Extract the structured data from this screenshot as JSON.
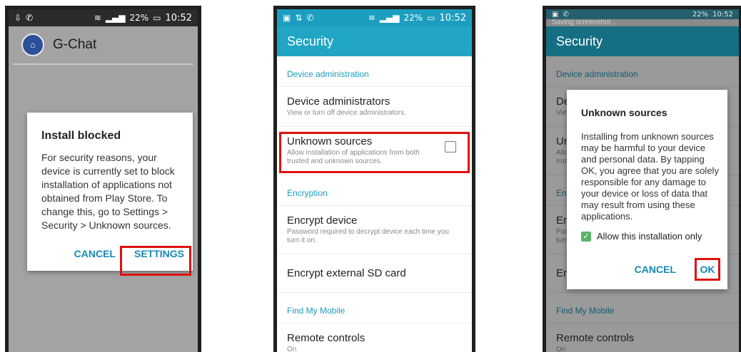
{
  "status_bar": {
    "time": "10:52",
    "battery": "22%"
  },
  "phone1": {
    "app_title": "G-Chat",
    "dialog": {
      "title": "Install blocked",
      "body": "For security reasons, your device is currently set to block installation of applications not obtained from Play Store. To change this, go to Settings > Security > Unknown sources.",
      "cancel_label": "CANCEL",
      "settings_label": "SETTINGS"
    }
  },
  "security": {
    "title": "Security",
    "device_admin_header": "Device administration",
    "device_admins_title": "Device administrators",
    "device_admins_sub": "View or turn off device administrators.",
    "unknown_sources_title": "Unknown sources",
    "unknown_sources_sub": "Allow installation of applications from both trusted and unknown sources.",
    "encryption_header": "Encryption",
    "encrypt_device_title": "Encrypt device",
    "encrypt_device_sub": "Password required to decrypt device each time you turn it on.",
    "encrypt_sd_title": "Encrypt external SD card",
    "find_my_mobile_header": "Find My Mobile",
    "remote_controls_title": "Remote controls",
    "remote_controls_sub": "On"
  },
  "phone3": {
    "saving_screenshot": "Saving screenshot...",
    "dialog": {
      "title": "Unknown sources",
      "body": "Installing from unknown sources may be harmful to your device and personal data. By tapping OK, you agree that you are solely responsible for any damage to your device or loss of data that may result from using these applications.",
      "checkbox_label": "Allow this installation only",
      "cancel_label": "CANCEL",
      "ok_label": "OK"
    }
  },
  "colors": {
    "accent": "#1a9cbd",
    "highlight": "#e01010",
    "check": "#5bb36a"
  }
}
